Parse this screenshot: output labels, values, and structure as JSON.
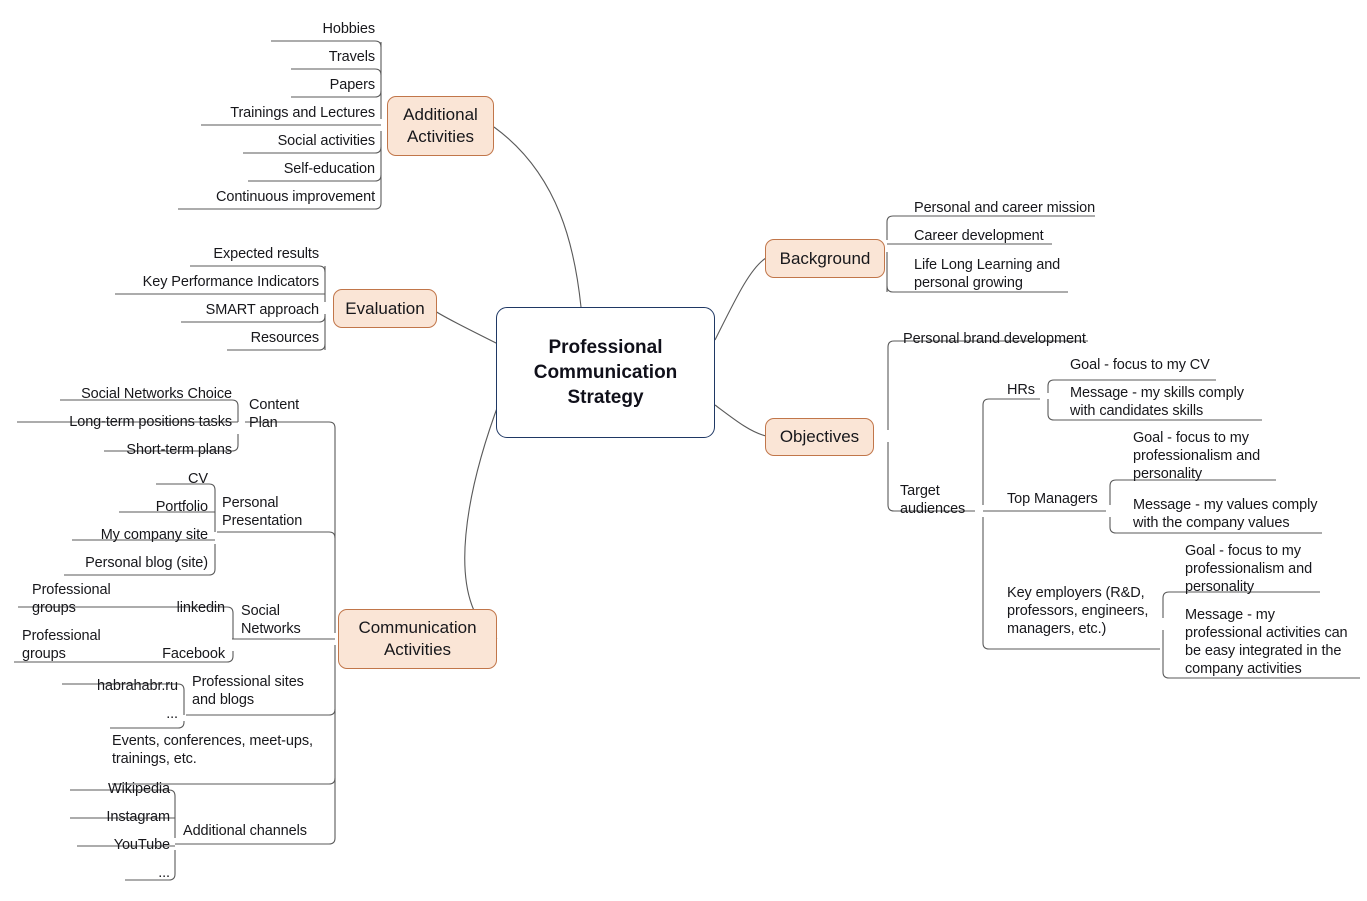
{
  "diagram": {
    "title": "Professional Communication Strategy",
    "type": "mind-map",
    "colors": {
      "branch_fill": "#fae5d6",
      "branch_border": "#c1764a",
      "center_fill": "#ffffff",
      "center_border": "#1f3864",
      "line": "#595959",
      "text": "#17171b"
    }
  },
  "center": {
    "label": "Professional\nCommunication\nStrategy"
  },
  "branches": {
    "additional_activities": {
      "label": "Additional\nActivities",
      "children": [
        {
          "label": "Hobbies"
        },
        {
          "label": "Travels"
        },
        {
          "label": "Papers"
        },
        {
          "label": "Trainings and Lectures"
        },
        {
          "label": "Social activities"
        },
        {
          "label": "Self-education"
        },
        {
          "label": "Continuous improvement"
        }
      ]
    },
    "evaluation": {
      "label": "Evaluation",
      "children": [
        {
          "label": "Expected results"
        },
        {
          "label": "Key Performance Indicators"
        },
        {
          "label": "SMART approach"
        },
        {
          "label": "Resources"
        }
      ]
    },
    "communication_activities": {
      "label": "Communication\nActivities",
      "children": [
        {
          "label": "Content\nPlan",
          "children": [
            {
              "label": "Social Networks Choice"
            },
            {
              "label": "Long-term positions tasks"
            },
            {
              "label": "Short-term plans"
            }
          ]
        },
        {
          "label": "Personal\nPresentation",
          "children": [
            {
              "label": "CV"
            },
            {
              "label": "Portfolio"
            },
            {
              "label": "My company site"
            },
            {
              "label": "Personal blog (site)"
            }
          ]
        },
        {
          "label": "Social\nNetworks",
          "children": [
            {
              "label": "linkedin",
              "children": [
                {
                  "label": "Professional\ngroups"
                }
              ]
            },
            {
              "label": "Facebook",
              "children": [
                {
                  "label": "Professional\ngroups"
                }
              ]
            }
          ]
        },
        {
          "label": "Professional sites\nand blogs",
          "children": [
            {
              "label": "habrahabr.ru"
            },
            {
              "label": "..."
            }
          ]
        },
        {
          "label": "Events, conferences, meet-ups,\ntrainings, etc."
        },
        {
          "label": "Additional channels",
          "children": [
            {
              "label": "Wikipedia"
            },
            {
              "label": "Instagram"
            },
            {
              "label": "YouTube"
            },
            {
              "label": "..."
            }
          ]
        }
      ]
    },
    "background": {
      "label": "Background",
      "children": [
        {
          "label": "Personal and career mission"
        },
        {
          "label": "Career development"
        },
        {
          "label": "Life Long Learning and\npersonal growing"
        }
      ]
    },
    "objectives": {
      "label": "Objectives",
      "children": [
        {
          "label": "Personal brand development"
        },
        {
          "label": "Target\naudiences",
          "children": [
            {
              "label": "HRs",
              "children": [
                {
                  "label": "Goal - focus to my CV"
                },
                {
                  "label": "Message - my skills comply\nwith candidates skills"
                }
              ]
            },
            {
              "label": "Top Managers",
              "children": [
                {
                  "label": "Goal - focus to my\nprofessionalism and\npersonality"
                },
                {
                  "label": "Message - my values comply\nwith the company values"
                }
              ]
            },
            {
              "label": "Key employers (R&D,\nprofessors, engineers,\nmanagers, etc.)",
              "children": [
                {
                  "label": "Goal - focus to my\nprofessionalism and\npersonality"
                },
                {
                  "label": "Message - my\nprofessional activities can\nbe easy integrated in the\ncompany activities"
                }
              ]
            }
          ]
        }
      ]
    }
  }
}
